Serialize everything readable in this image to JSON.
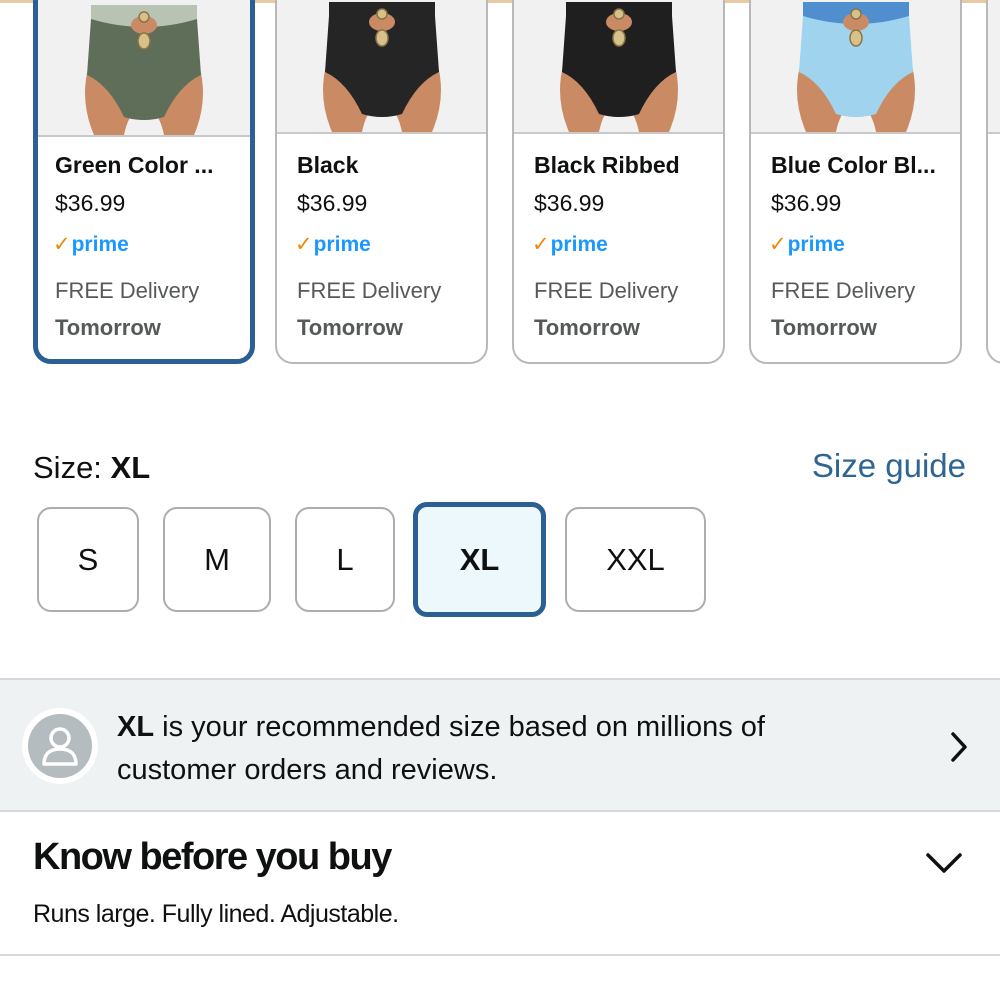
{
  "variants": [
    {
      "name": "Green Color ...",
      "price": "$36.99",
      "prime": "prime",
      "delivery": "FREE Delivery",
      "when": "Tomorrow",
      "color": "#5f6e58",
      "top_color": "#b9c3b3",
      "selected": true
    },
    {
      "name": "Black",
      "price": "$36.99",
      "prime": "prime",
      "delivery": "FREE Delivery",
      "when": "Tomorrow",
      "color": "#252525",
      "top_color": "#252525",
      "selected": false
    },
    {
      "name": "Black Ribbed",
      "price": "$36.99",
      "prime": "prime",
      "delivery": "FREE Delivery",
      "when": "Tomorrow",
      "color": "#1f1f1f",
      "top_color": "#1f1f1f",
      "selected": false
    },
    {
      "name": "Blue Color Bl...",
      "price": "$36.99",
      "prime": "prime",
      "delivery": "FREE Delivery",
      "when": "Tomorrow",
      "color": "#9fd3ee",
      "top_color": "#4f8fd0",
      "selected": false
    }
  ],
  "prime_check": "✓",
  "size": {
    "label": "Size: ",
    "selected_value": "XL",
    "guide_link": "Size guide",
    "options": [
      "S",
      "M",
      "L",
      "XL",
      "XXL"
    ]
  },
  "recommendation": {
    "bold": "XL",
    "text": " is your recommended size based on millions of customer orders and reviews."
  },
  "know_before_you_buy": {
    "title": "Know before you buy",
    "description": "Runs large. Fully lined. Adjustable."
  },
  "colors": {
    "accent": "#2c5f93",
    "link": "#2e6592",
    "prime_blue": "#1a98ff",
    "prime_check": "#f08804",
    "banner_bg": "#eff2f2",
    "selected_size_bg": "#edf8fc"
  },
  "icons": {
    "recommendation_avatar": "user-icon",
    "recommendation_arrow": "chevron-right-icon",
    "expand": "chevron-down-icon"
  }
}
